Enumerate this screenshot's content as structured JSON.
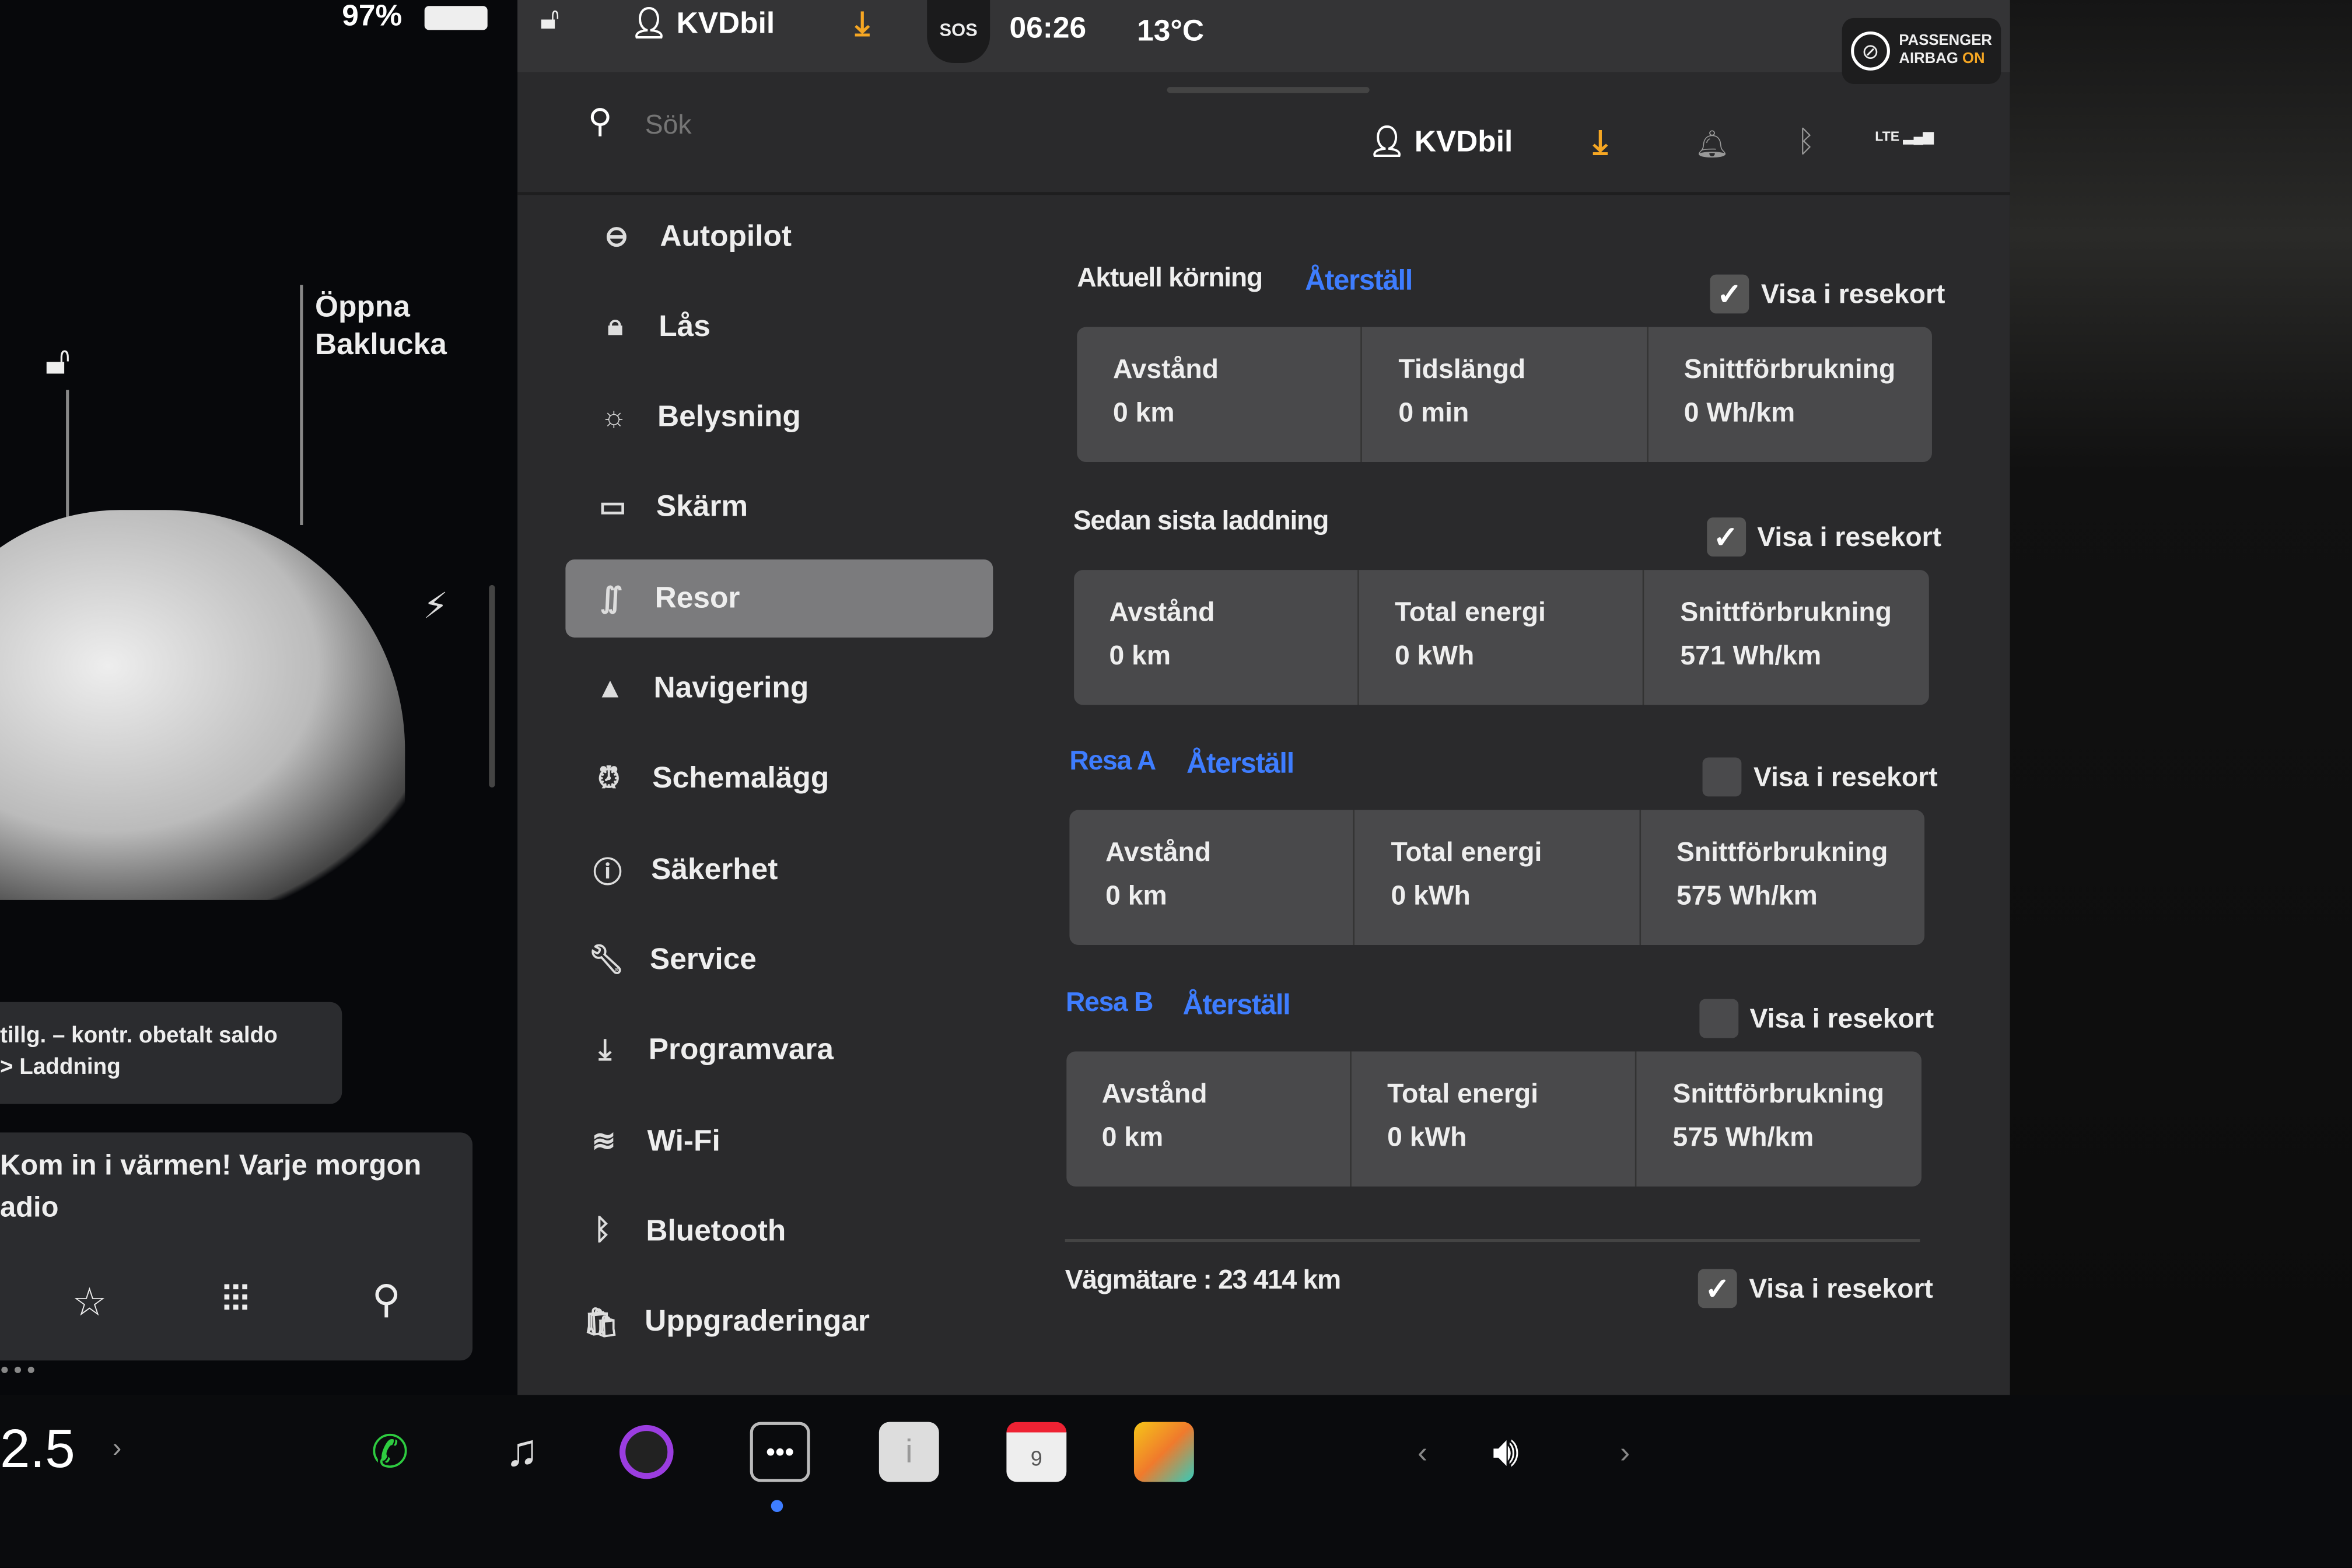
{
  "status": {
    "battery": "97%",
    "profile": "KVDbil",
    "time": "06:26",
    "temperature": "13°C",
    "sos": "SOS",
    "airbag_line1": "PASSENGER",
    "airbag_line2": "AIRBAG",
    "airbag_state": "ON"
  },
  "car_panel": {
    "trunk_label_1": "Öppna",
    "trunk_label_2": "Baklucka",
    "notice_line1": "tillg. – kontr. obetalt saldo",
    "notice_line2": "> Laddning",
    "media_text1": "Kom in i värmen! Varje morgon",
    "media_text2": "adio",
    "speed": "2.5"
  },
  "header": {
    "search_placeholder": "Sök",
    "profile": "KVDbil",
    "lte": "LTE"
  },
  "menu": [
    {
      "label": "Autopilot",
      "icon": "steering-wheel-icon"
    },
    {
      "label": "Lås",
      "icon": "lock-icon"
    },
    {
      "label": "Belysning",
      "icon": "sun-icon"
    },
    {
      "label": "Skärm",
      "icon": "display-icon"
    },
    {
      "label": "Resor",
      "icon": "trips-icon",
      "selected": true
    },
    {
      "label": "Navigering",
      "icon": "navigation-icon"
    },
    {
      "label": "Schemalägg",
      "icon": "schedule-icon"
    },
    {
      "label": "Säkerhet",
      "icon": "safety-icon"
    },
    {
      "label": "Service",
      "icon": "wrench-icon"
    },
    {
      "label": "Programvara",
      "icon": "download-icon"
    },
    {
      "label": "Wi-Fi",
      "icon": "wifi-icon"
    },
    {
      "label": "Bluetooth",
      "icon": "bluetooth-icon"
    },
    {
      "label": "Uppgraderingar",
      "icon": "shopping-bag-icon"
    }
  ],
  "trips": {
    "show_label": "Visa i resekort",
    "reset_label": "Återställ",
    "current": {
      "title": "Aktuell körning",
      "checked": true,
      "cells": [
        [
          "Avstånd",
          "0 km"
        ],
        [
          "Tidslängd",
          "0 min"
        ],
        [
          "Snittförbrukning",
          "0 Wh/km"
        ]
      ]
    },
    "since_charge": {
      "title": "Sedan sista laddning",
      "checked": true,
      "cells": [
        [
          "Avstånd",
          "0 km"
        ],
        [
          "Total energi",
          "0 kWh"
        ],
        [
          "Snittförbrukning",
          "571 Wh/km"
        ]
      ]
    },
    "trip_a": {
      "title": "Resa A",
      "checked": false,
      "cells": [
        [
          "Avstånd",
          "0 km"
        ],
        [
          "Total energi",
          "0 kWh"
        ],
        [
          "Snittförbrukning",
          "575 Wh/km"
        ]
      ]
    },
    "trip_b": {
      "title": "Resa B",
      "checked": false,
      "cells": [
        [
          "Avstånd",
          "0 km"
        ],
        [
          "Total energi",
          "0 kWh"
        ],
        [
          "Snittförbrukning",
          "575 Wh/km"
        ]
      ]
    },
    "odometer": {
      "label": "Vägmätare : 23 414 km",
      "checked": true
    }
  },
  "dock": {
    "calendar_day": "9"
  },
  "colors": {
    "accent_blue": "#3e7dff",
    "download_orange": "#f5a623",
    "phone_green": "#2ecc40"
  }
}
